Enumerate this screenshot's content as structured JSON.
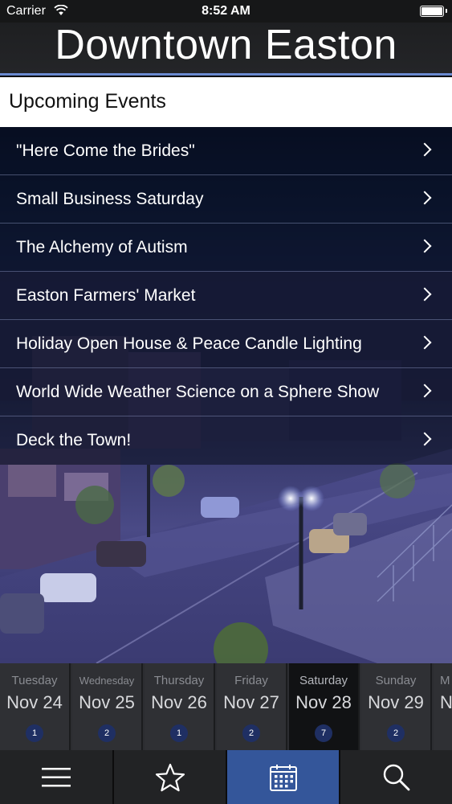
{
  "status_bar": {
    "carrier": "Carrier",
    "time": "8:52 AM"
  },
  "header": {
    "title": "Downtown Easton"
  },
  "section": {
    "title": "Upcoming Events"
  },
  "events": [
    {
      "label": "\"Here Come the Brides\""
    },
    {
      "label": "Small Business Saturday"
    },
    {
      "label": "The Alchemy of Autism"
    },
    {
      "label": "Easton Farmers' Market"
    },
    {
      "label": "Holiday Open House & Peace Candle Lighting"
    },
    {
      "label": "World Wide Weather Science on a Sphere Show"
    },
    {
      "label": "Deck the Town!"
    }
  ],
  "dates": [
    {
      "day": "Tuesday",
      "date": "Nov 24",
      "count": "1"
    },
    {
      "day": "Wednesday",
      "date": "Nov 25",
      "count": "2"
    },
    {
      "day": "Thursday",
      "date": "Nov 26",
      "count": "1"
    },
    {
      "day": "Friday",
      "date": "Nov 27",
      "count": "2"
    },
    {
      "day": "Saturday",
      "date": "Nov 28",
      "count": "7",
      "selected": true
    },
    {
      "day": "Sunday",
      "date": "Nov 29",
      "count": "2"
    },
    {
      "day": "M",
      "date": "N"
    }
  ],
  "tabs": [
    {
      "icon": "menu-icon"
    },
    {
      "icon": "star-icon"
    },
    {
      "icon": "calendar-icon",
      "active": true
    },
    {
      "icon": "search-icon"
    }
  ],
  "colors": {
    "header_accent": "#6a8ad0",
    "active_tab": "#34569a",
    "badge": "#1f2f63"
  }
}
